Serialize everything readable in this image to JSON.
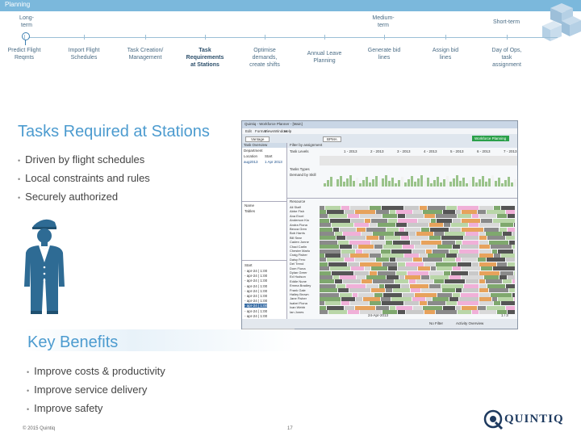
{
  "header": {
    "section_label": "Planning"
  },
  "timeline": {
    "long_term": "Long-\nterm",
    "medium_term": "Medium-\nterm",
    "short_term": "Short-term",
    "steps": [
      {
        "label": "Predict Flight Reqmts",
        "bold": false
      },
      {
        "label": "Import Flight Schedules",
        "bold": false
      },
      {
        "label": "Task Creation/ Management",
        "bold": false
      },
      {
        "label": "Task Requirements at Stations",
        "bold": true
      },
      {
        "label": "Optimise demands, create shifts",
        "bold": false
      },
      {
        "label": "Annual Leave Planning",
        "bold": false
      },
      {
        "label": "Generate bid lines",
        "bold": false
      },
      {
        "label": "Assign bid lines",
        "bold": false
      },
      {
        "label": "Day of Ops, task assignment",
        "bold": false
      }
    ]
  },
  "main": {
    "title": "Tasks Required at Stations",
    "bullets": [
      "Driven by flight schedules",
      "Local constraints and rules",
      "Securely authorized"
    ]
  },
  "benefits": {
    "title": "Key Benefits",
    "bullets": [
      "Improve costs & productivity",
      "Improve service delivery",
      "Improve safety"
    ]
  },
  "footer": {
    "copyright": "© 2015 Quintiq",
    "page_number": "17"
  },
  "logo": {
    "text": "QUINTIQ"
  },
  "screenshot": {
    "window_title": "Quintiq - Workforce Planner - [Main]",
    "menu": [
      "Edit",
      "Format",
      "Views",
      "Window",
      "Help"
    ],
    "toolbar_left": "Vantage",
    "toolbar_right": "BPMA",
    "green_button": "Workforce Planning",
    "filter_label": "Filter by assignment",
    "left_panel_title": "Task Overview",
    "left_panel_header": "Department",
    "left_panel_cols": [
      "Location",
      "Start"
    ],
    "left_panel_row": [
      "aug2013",
      "1 Apr 2013"
    ],
    "main_section1": "Task Levels",
    "main_section2": "Tasks Types",
    "main_section2_sub": "Demand by Skill",
    "detail_header": "Name",
    "detail_row": "Tables",
    "lower_list_header": "Start",
    "lower_list": [
      "- apr-24 | 1:00",
      "- apr-24 | 1:00",
      "- apr-24 | 1:00",
      "- apr-24 | 1:00",
      "- apr-24 | 1:00",
      "- apr-24 | 1:00",
      "- apr-24 | 1:00",
      "- apr-24 | 1:00",
      "- apr-24 | 1:00",
      "- apr-24 | 1:00",
      "- apr-24 | 1:00",
      "- apr-24 | 1:00"
    ],
    "timeline_dates": [
      "1 - 2013",
      "2 - 2013",
      "3 - 2013",
      "4 - 2013",
      "5 - 2013",
      "6 - 2013",
      "7 - 2013"
    ],
    "roster_header": "Resource",
    "roster": [
      "All Staff",
      "Abbe Fish",
      "Ana Ercel",
      "Anderson Kio",
      "Andra Fiona",
      "Becca Gren",
      "Bob Harris",
      "Bill Sear",
      "Caden Jonne",
      "Chad Carlin",
      "Chester Marlo",
      "Craig Fisher",
      "Daisy Fero",
      "Del Trend",
      "Dom Fiona",
      "Dylan Greer",
      "Ed Hudson",
      "Eddie Nune",
      "Emma Bradley",
      "Frank Gale",
      "Hailey Brown",
      "Jane Fisher",
      "Isabel Fiona",
      "Ivan Webb",
      "Ian Jones"
    ],
    "status_text": "No Filter",
    "status_text2": "Activity Overview",
    "bottom_date": "24-Apr-2013",
    "week_label": "1 / 3"
  },
  "colors": {
    "accent": "#4c9bcf",
    "topbar": "#7bb8dc",
    "green": "#2aa04a"
  },
  "icons": [
    "cube-logo-icon",
    "person-illustration",
    "quintiq-logo"
  ]
}
